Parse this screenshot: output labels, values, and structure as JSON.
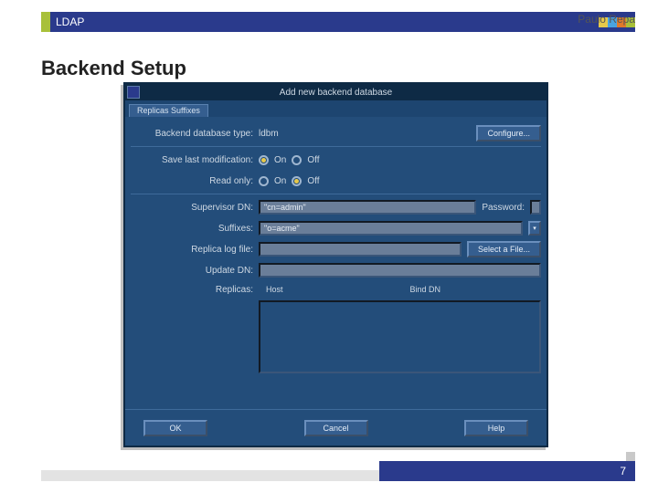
{
  "topbar": {
    "title": "LDAP",
    "author": "Paulo Repa"
  },
  "heading": "Backend Setup",
  "window": {
    "title": "Add new backend database",
    "tab": "Replicas Suffixes",
    "fields": {
      "dbtype_label": "Backend database type:",
      "dbtype_value": "ldbm",
      "configure_btn": "Configure...",
      "savemod_label": "Save last modification:",
      "on_label": "On",
      "off_label": "Off",
      "readonly_label": "Read only:",
      "supervisor_label": "Supervisor DN:",
      "supervisor_value": "\"cn=admin\"",
      "password_label": "Password:",
      "suffixes_label": "Suffixes:",
      "suffixes_value": "\"o=acme\"",
      "replicalog_label": "Replica log file:",
      "selectfile_btn": "Select a File...",
      "updatedn_label": "Update DN:",
      "replicas_label": "Replicas:",
      "col_host": "Host",
      "col_bind": "Bind DN"
    },
    "buttons": {
      "ok": "OK",
      "cancel": "Cancel",
      "help": "Help"
    }
  },
  "footer": {
    "page": "7"
  },
  "colors": {
    "c1": "#e7c94a",
    "c2": "#4aa3e0",
    "c3": "#e07a2a",
    "c4": "#a8c03a"
  }
}
